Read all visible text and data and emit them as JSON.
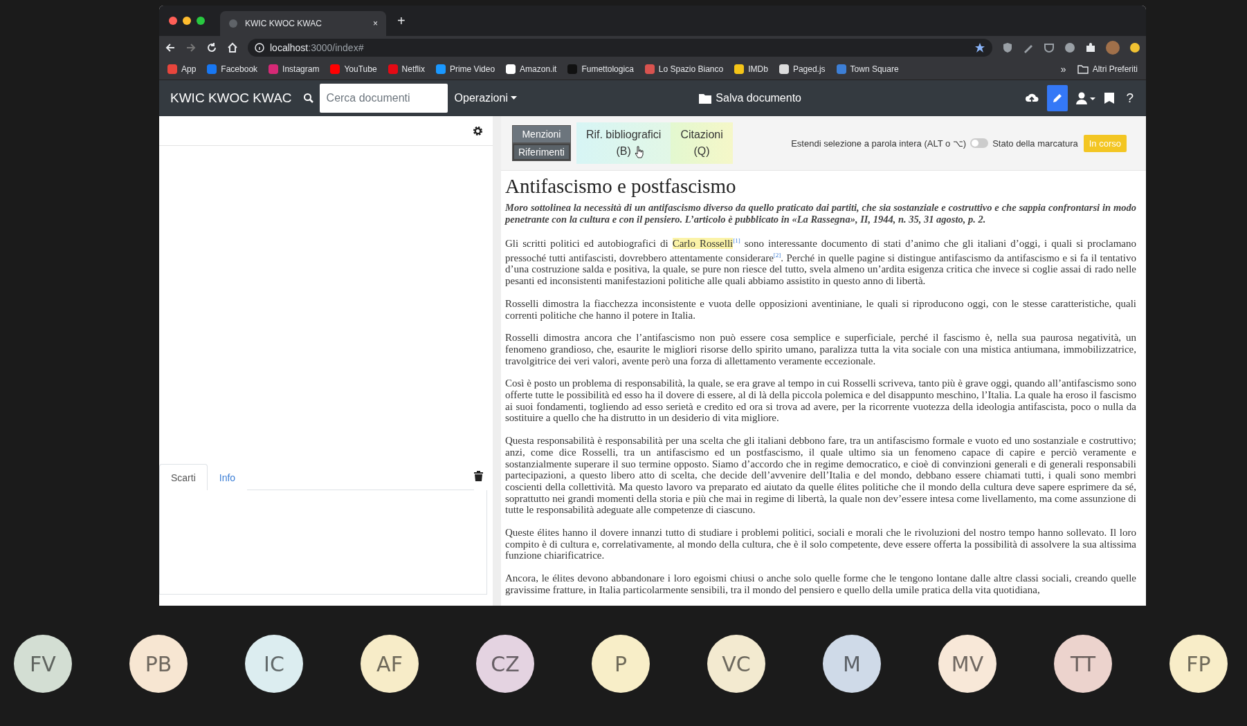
{
  "browser": {
    "tab": {
      "title": "KWIC KWOC KWAC",
      "close": "×"
    },
    "new_tab": "+",
    "address": {
      "host": "localhost",
      "path": ":3000/index#"
    },
    "bookmarks": [
      {
        "label": "App",
        "color": "#e8453c"
      },
      {
        "label": "Facebook",
        "color": "#1877f2"
      },
      {
        "label": "Instagram",
        "color": "#d62976"
      },
      {
        "label": "YouTube",
        "color": "#ff0000"
      },
      {
        "label": "Netflix",
        "color": "#e50914"
      },
      {
        "label": "Prime Video",
        "color": "#1a98ff"
      },
      {
        "label": "Amazon.it",
        "color": "#ffffff"
      },
      {
        "label": "Fumettologica",
        "color": "#111111"
      },
      {
        "label": "Lo Spazio Bianco",
        "color": "#d9534f"
      },
      {
        "label": "IMDb",
        "color": "#f5c518"
      },
      {
        "label": "Paged.js",
        "color": "#dddddd"
      },
      {
        "label": "Town Square",
        "color": "#3d7fd6"
      }
    ],
    "more": "»",
    "other_bookmarks": "Altri Preferiti"
  },
  "navbar": {
    "brand": "KWIC KWOC KWAC",
    "search": {
      "placeholder": "Cerca documenti"
    },
    "menu": "Operazioni",
    "save": "Salva documento",
    "help": "?"
  },
  "left_panel": {
    "tabs": [
      {
        "label": "Scarti",
        "selected": true
      },
      {
        "label": "Info",
        "selected": false
      }
    ]
  },
  "toolbar": {
    "buttons": [
      {
        "kind": "stack",
        "labels": [
          "Menzioni",
          "Riferimenti"
        ]
      },
      {
        "kind": "biblio",
        "labels": [
          "Rif. bibliografici",
          "(B)"
        ]
      },
      {
        "kind": "quote",
        "labels": [
          "Citazioni",
          "(Q)"
        ]
      }
    ],
    "extend_label": "Estendi selezione a parola intera (ALT o ⌥)",
    "extend_on": false,
    "status_label": "Stato della marcatura",
    "status": "In corso"
  },
  "document": {
    "title": "Antifascismo e postfascismo",
    "abstract": "Moro sottolinea la necessità di un antifascismo diverso da quello praticato dai partiti, che sia sostanziale e costruttivo e che sappia confrontarsi in modo penetrante con la cultura e con il pensiero. L’articolo è pubblicato in «La Rassegna», II, 1944, n. 35, 31 agosto, p. 2.",
    "paragraphs": [
      [
        {
          "kind": "text",
          "text": "Gli scritti politici ed autobiografici di "
        },
        {
          "kind": "mention",
          "text": "Carlo Rosselli"
        },
        {
          "kind": "note",
          "text": "[1]"
        },
        {
          "kind": "text",
          "text": " sono interessante documento di stati d’animo che gli italiani d’oggi, i quali si proclamano pressoché tutti antifascisti, dovrebbero attentamente considerare"
        },
        {
          "kind": "note",
          "text": "[2]"
        },
        {
          "kind": "text",
          "text": ". Perché in quelle pagine si distingue antifascismo da antifascismo e si fa il tentativo d’una costruzione salda e positiva, la quale, se pure non riesce del tutto, svela almeno un’ardita esigenza critica che invece si coglie assai di rado nelle pesanti ed inconsistenti manifestazioni politiche alle quali abbiamo assistito in questo anno di libertà."
        }
      ],
      [
        {
          "kind": "text",
          "text": "Rosselli dimostra la fiacchezza inconsistente e vuota delle opposizioni aventiniane, le quali si riproducono oggi, con le stesse caratteristiche, quali correnti politiche che hanno il potere in Italia."
        }
      ],
      [
        {
          "kind": "text",
          "text": "Rosselli dimostra ancora che l’antifascismo non può essere cosa semplice e superficiale, perché il fascismo è, nella sua paurosa negatività, un fenomeno grandioso, che, esaurite le migliori risorse dello spirito umano, paralizza tutta la vita sociale con una mistica antiumana, immobilizzatrice, travolgitrice dei veri valori, avente però una forza di allettamento veramente eccezionale."
        }
      ],
      [
        {
          "kind": "text",
          "text": "Così è posto un problema di responsabilità, la quale, se era grave al tempo in cui Rosselli scriveva, tanto più è grave oggi, quando all’antifascismo sono offerte tutte le possibilità ed esso ha il dovere di essere, al di là della piccola polemica e del disappunto meschino, l’Italia. La quale ha eroso il fascismo ai suoi fondamenti, togliendo ad esso serietà e credito ed ora si trova ad avere, per la ricorrente vuotezza della ideologia antifascista, poco o nulla da sostituire a quello che ha distrutto in un desiderio di vita migliore."
        }
      ],
      [
        {
          "kind": "text",
          "text": "Questa responsabilità è responsabilità per una scelta che gli italiani debbono fare, tra un antifascismo formale e vuoto ed uno sostanziale e costruttivo; anzi, come dice Rosselli, tra un antifascismo ed un postfascismo, il quale ultimo sia un fenomeno capace di capire e perciò veramente e sostanzialmente superare il suo termine opposto. Siamo d’accordo che in regime democratico, e cioè di convinzioni generali e di generali responsabili partecipazioni, a questo libero atto di scelta, che decide dell’avvenire dell’Italia e del mondo, debbano essere chiamati tutti, i quali sono membri coscienti della collettività. Ma questo lavoro va preparato ed aiutato da quelle élites politiche che il mondo della cultura deve sapere esprimere da sé, soprattutto nei grandi momenti della storia e più che mai in regime di libertà, la quale non dev’essere intesa come livellamento, ma come assunzione di tutte le responsabilità adeguate alle competenze di ciascuno."
        }
      ],
      [
        {
          "kind": "text",
          "text": "Queste élites hanno il dovere innanzi tutto di studiare i problemi politici, sociali e morali che le rivoluzioni del nostro tempo hanno sollevato. Il loro compito è di cultura e, correlativamente, al mondo della cultura, che è il solo competente, deve essere offerta la possibilità di assolvere la sua altissima funzione chiarificatrice."
        }
      ],
      [
        {
          "kind": "text",
          "text": "Ancora, le élites devono abbandonare i loro egoismi chiusi o anche solo quelle forme che le tengono lontane dalle altre classi sociali, creando quelle gravissime fratture, in Italia particolarmente sensibili, tra il mondo del pensiero e quello della umile pratica della vita quotidiana,"
        }
      ]
    ]
  },
  "participants": [
    {
      "initials": "FV",
      "color": "#d3ded3"
    },
    {
      "initials": "PB",
      "color": "#f7e6d2"
    },
    {
      "initials": "IC",
      "color": "#dcedf0"
    },
    {
      "initials": "AF",
      "color": "#f7ecc8"
    },
    {
      "initials": "CZ",
      "color": "#e4d3e1"
    },
    {
      "initials": "P",
      "color": "#f8eec8"
    },
    {
      "initials": "VC",
      "color": "#f3ead0"
    },
    {
      "initials": "M",
      "color": "#cfdae8"
    },
    {
      "initials": "MV",
      "color": "#f8e8d8"
    },
    {
      "initials": "TT",
      "color": "#ecd3cd"
    },
    {
      "initials": "FP",
      "color": "#f8edc8"
    }
  ]
}
